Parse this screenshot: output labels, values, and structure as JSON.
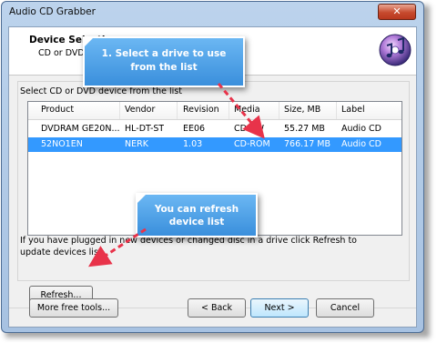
{
  "window": {
    "title": "Audio CD Grabber",
    "close_label": "✕"
  },
  "header": {
    "title": "Device Selection",
    "subtitle": "CD or DVD"
  },
  "group": {
    "label": "Select CD or DVD device from the list"
  },
  "table": {
    "columns": [
      "Product",
      "Vendor",
      "Revision",
      "Media",
      "Size, MB",
      "Label"
    ],
    "rows": [
      [
        "DVDRAM GE20N...",
        "HL-DT-ST",
        "EE06",
        "CD-RW",
        "55.27 MB",
        "Audio CD"
      ],
      [
        "52NO1EN",
        "NERK",
        "1.03",
        "CD-ROM",
        "766.17 MB",
        "Audio CD"
      ]
    ],
    "selected_row": 1
  },
  "info": {
    "text": "If you have plugged in new devices or changed disc in a drive click Refresh to update devices list"
  },
  "buttons": {
    "refresh": "Refresh...",
    "more_tools": "More free tools...",
    "back": "< Back",
    "next": "Next >",
    "cancel": "Cancel"
  },
  "callouts": {
    "select": {
      "line1": "1. Select a drive to use",
      "line2": "from the list"
    },
    "refresh": {
      "line1": "You can refresh",
      "line2": "device list"
    }
  },
  "colors": {
    "accent": "#3399ff",
    "callout": "#4a9de6",
    "arrow": "#e8334a"
  }
}
